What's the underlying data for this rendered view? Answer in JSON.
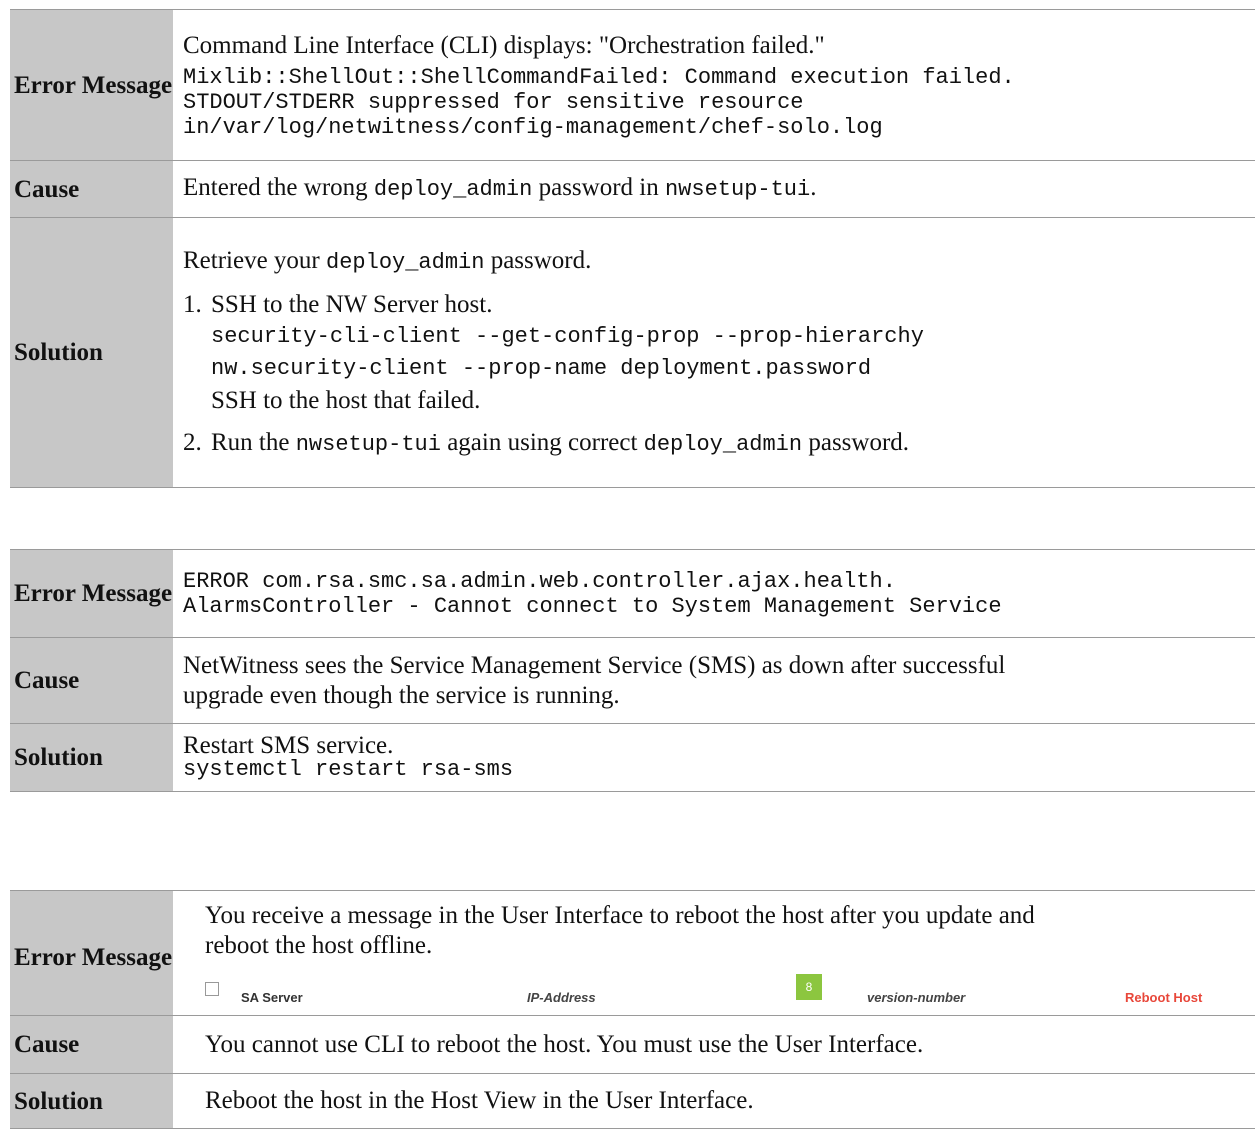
{
  "table1": {
    "error_label": "Error Message",
    "error_line1": "Command Line Interface (CLI) displays: \"Orchestration failed.\"",
    "error_code_lines": [
      "Mixlib::ShellOut::ShellCommandFailed: Command execution failed.",
      "STDOUT/STDERR suppressed for sensitive resource",
      "in/var/log/netwitness/config-management/chef-solo.log"
    ],
    "cause_label": "Cause",
    "cause_pre": "Entered the wrong ",
    "cause_code1": "deploy_admin",
    "cause_mid": " password in ",
    "cause_code2": "nwsetup-tui",
    "cause_post": ".",
    "solution_label": "Solution",
    "solution_intro_pre": "Retrieve your ",
    "solution_intro_code": "deploy_admin",
    "solution_intro_post": " password.",
    "step1_num": "1.",
    "step1_text": "SSH to the NW Server host.",
    "step1_code1": "security-cli-client --get-config-prop --prop-hierarchy",
    "step1_code2": "nw.security-client --prop-name deployment.password",
    "step1_text2": "SSH to the host that failed.",
    "step2_num": "2.",
    "step2_pre": "Run the ",
    "step2_code1": "nwsetup-tui",
    "step2_mid": " again using correct ",
    "step2_code2": "deploy_admin",
    "step2_post": " password."
  },
  "table2": {
    "error_label": "Error Message",
    "error_code_lines": [
      "ERROR com.rsa.smc.sa.admin.web.controller.ajax.health.",
      "AlarmsController - Cannot connect to System Management Service"
    ],
    "cause_label": "Cause",
    "cause_line1": "NetWitness sees the Service Management Service (SMS) as down after successful",
    "cause_line2": "upgrade even though the service is running.",
    "solution_label": "Solution",
    "solution_text": "Restart SMS service.",
    "solution_code": "systemctl restart rsa-sms"
  },
  "table3": {
    "error_label": "Error Message",
    "error_line1": "You receive a message in the User Interface to reboot the host after you update and",
    "error_line2": "reboot the host offline.",
    "screenshot_row": {
      "host_name": "SA Server",
      "ip": "IP-Address",
      "badge": "8",
      "version": "version-number",
      "action": "Reboot Host"
    },
    "cause_label": "Cause",
    "cause_text": "You cannot use CLI to reboot the host. You must use the User Interface.",
    "solution_label": "Solution",
    "solution_text": "Reboot the host in the Host View in the User Interface."
  },
  "colors": {
    "label_bg": "#c7c7c7",
    "badge_green": "#8cc63f",
    "reboot_red": "#e8473a"
  }
}
